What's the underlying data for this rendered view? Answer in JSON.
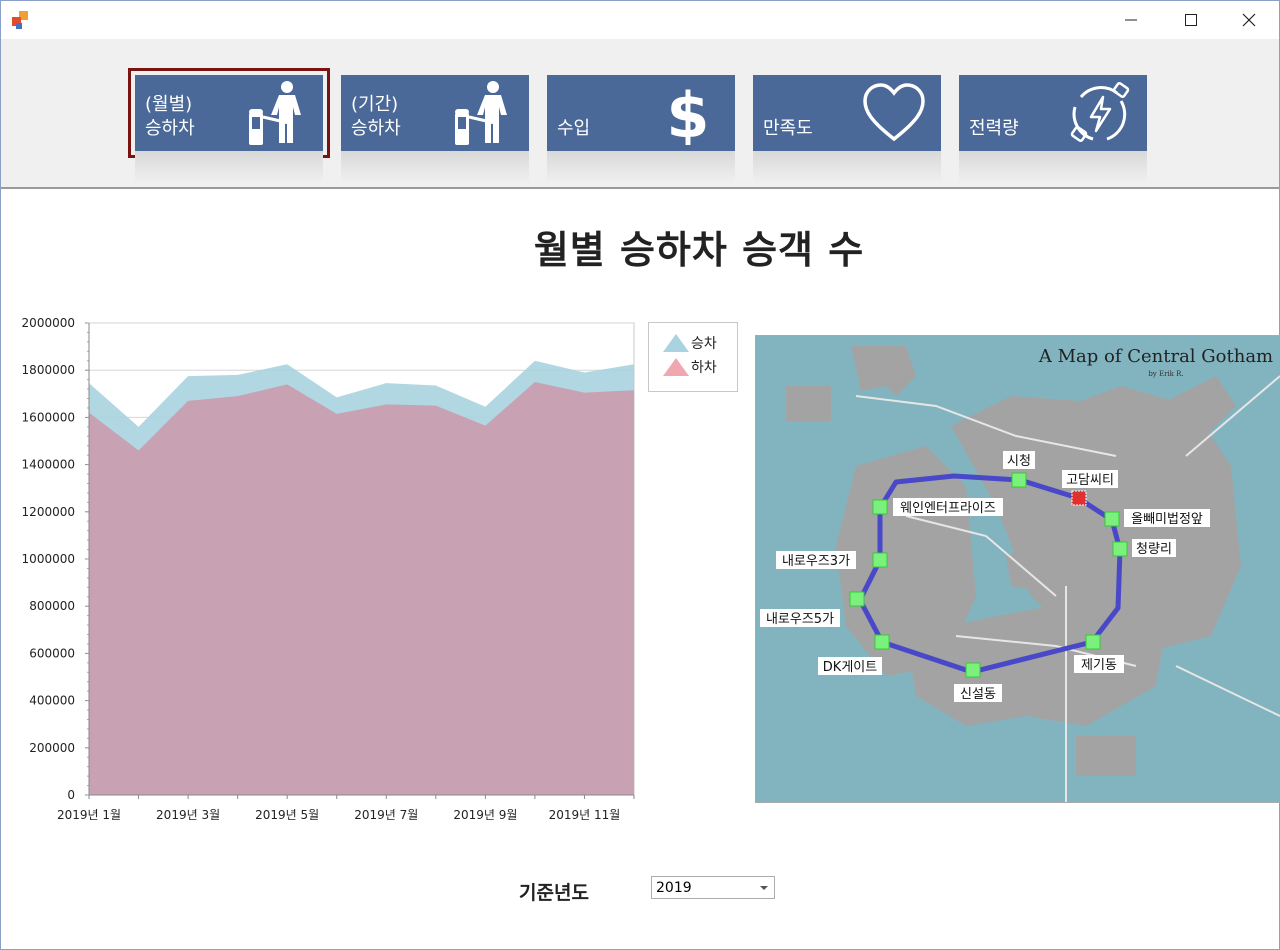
{
  "window": {
    "controls": {
      "minimize": "—",
      "maximize": "☐",
      "close": "✕"
    }
  },
  "nav": {
    "buttons": [
      {
        "label": "(월별)\n승하차",
        "icon": "turnstile-person-icon",
        "selected": true
      },
      {
        "label": "(기간)\n승하차",
        "icon": "turnstile-person-icon",
        "selected": false
      },
      {
        "label": "수입",
        "icon": "dollar-icon",
        "selected": false
      },
      {
        "label": "만족도",
        "icon": "heart-icon",
        "selected": false
      },
      {
        "label": "전력량",
        "icon": "power-cycle-icon",
        "selected": false
      }
    ],
    "color": "#4a6999",
    "selected_outline": "#7a1212"
  },
  "main": {
    "title": "월별 승하차 승객 수"
  },
  "chart_data": {
    "type": "area",
    "x": [
      "2019년 1월",
      "2019년 2월",
      "2019년 3월",
      "2019년 4월",
      "2019년 5월",
      "2019년 6월",
      "2019년 7월",
      "2019년 8월",
      "2019년 9월",
      "2019년 10월",
      "2019년 11월",
      "2019년 12월"
    ],
    "x_tick_labels": [
      "2019년 1월",
      "2019년 3월",
      "2019년 5월",
      "2019년 7월",
      "2019년 9월",
      "2019년 11월"
    ],
    "series": [
      {
        "name": "승차",
        "color": "#a9d3e0",
        "values": [
          1745000,
          1560000,
          1775000,
          1780000,
          1825000,
          1685000,
          1745000,
          1735000,
          1645000,
          1840000,
          1790000,
          1825000
        ]
      },
      {
        "name": "하차",
        "color": "#c8a2b2",
        "values": [
          1620000,
          1460000,
          1670000,
          1690000,
          1740000,
          1615000,
          1655000,
          1650000,
          1565000,
          1750000,
          1705000,
          1715000
        ]
      }
    ],
    "y_ticks": [
      "0",
      "200000",
      "400000",
      "600000",
      "800000",
      "1000000",
      "1200000",
      "1400000",
      "1600000",
      "1800000",
      "2000000"
    ],
    "ylim": [
      0,
      2000000
    ],
    "grid": true,
    "legend": "right"
  },
  "map": {
    "title": "A Map of Central Gotham",
    "byline": "by Erik R.",
    "line_color": "#4848c8",
    "stations": [
      {
        "name": "시청"
      },
      {
        "name": "고담씨티"
      },
      {
        "name": "웨인엔터프라이즈"
      },
      {
        "name": "올빼미법정앞"
      },
      {
        "name": "청량리"
      },
      {
        "name": "내로우즈3가"
      },
      {
        "name": "내로우즈5가"
      },
      {
        "name": "DK게이트"
      },
      {
        "name": "제기동"
      },
      {
        "name": "신설동"
      }
    ]
  },
  "filter": {
    "label": "기준년도",
    "value": "2019"
  }
}
